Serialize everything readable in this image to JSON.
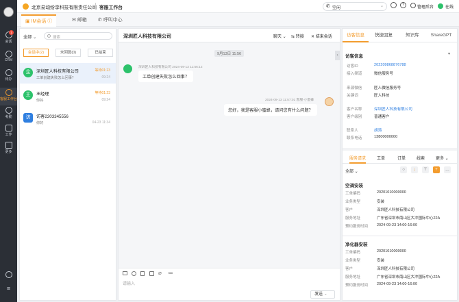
{
  "topbar": {
    "company": "北京易动纷享科技有限责任公司",
    "workspace": "客服工作台",
    "status_label": "空闲",
    "admin_label": "管理后台",
    "online_label": "在线"
  },
  "nav": {
    "items": [
      {
        "label": "会话",
        "badge": "1"
      },
      {
        "label": "CRM"
      },
      {
        "label": "待办"
      },
      {
        "label": "客服工作台"
      },
      {
        "label": "考勤"
      },
      {
        "label": "工作"
      },
      {
        "label": "更多"
      }
    ]
  },
  "tabs": [
    {
      "label": "IM会话"
    },
    {
      "label": "邮箱"
    },
    {
      "label": "呼叫中心"
    }
  ],
  "convlist": {
    "scope": "全部",
    "search_placeholder": "搜索",
    "filters": [
      "会话中(2)",
      "未回复(0)",
      "已结束"
    ],
    "items": [
      {
        "name": "深圳匠人科技有限公司",
        "msg": "工单创建失败怎么回事？",
        "time": "等待01:23",
        "time2": "09:24",
        "avatar": "企"
      },
      {
        "name": "王经理",
        "msg": "你好",
        "time": "等待01:23",
        "time2": "09:24",
        "avatar": "王"
      },
      {
        "name": "访客2203345556",
        "msg": "你好",
        "time": "",
        "time2": "04-23 11:34",
        "avatar": "访"
      }
    ]
  },
  "chat": {
    "title": "深圳匠人科技有限公司",
    "actions": {
      "chat": "聊天",
      "transfer": "转接",
      "end": "结束会话"
    },
    "date_divider": "9月13日 11:56",
    "msg1": {
      "meta": "深圳匠人科技有限公司 2024-09-13 11:56:12",
      "text": "工单创建失败怎么回事？"
    },
    "msg2": {
      "meta": "2024-09-13 11:57:01 客服-小蜜蜂",
      "text": "您好，我是客服小蜜蜂，请问您有什么问题？"
    },
    "input_placeholder": "请输入",
    "send_label": "发送"
  },
  "right": {
    "tabs": [
      "访客信息",
      "快捷回复",
      "知识库",
      "ShareGPT"
    ],
    "section_title": "访客信息",
    "fields": [
      {
        "k": "访客ID",
        "v": "202209868876788",
        "link": true
      },
      {
        "k": "接入渠道",
        "v": "微信服务号"
      },
      {
        "k": "来源微信",
        "v": "匠人微信服务号"
      },
      {
        "k": "关键词",
        "v": "匠人科技"
      },
      {
        "k": "客户名称",
        "v": "深圳匠人科技有限公司",
        "link": true
      },
      {
        "k": "客户级别",
        "v": "普通客户"
      },
      {
        "k": "联系人",
        "v": "胡涛",
        "link": true
      },
      {
        "k": "联系电话",
        "v": "13800000000"
      }
    ],
    "subtabs": [
      "服务请求",
      "工单",
      "订单",
      "线索",
      "更多"
    ],
    "scope": "全部",
    "cards": [
      {
        "title": "空调安装",
        "rows": [
          [
            "工单编码",
            "20201010000000"
          ],
          [
            "业务类型",
            "安装"
          ],
          [
            "客户",
            "深圳匠人科技有限公司"
          ],
          [
            "服务地址",
            "广东省深圳市南山区大冲国际中心22A"
          ],
          [
            "预约服务时间",
            "2024-09-23 14:00-16:00"
          ]
        ]
      },
      {
        "title": "净化器安装",
        "rows": [
          [
            "工单编码",
            "20201010000000"
          ],
          [
            "业务类型",
            "安装"
          ],
          [
            "客户",
            "深圳匠人科技有限公司"
          ],
          [
            "服务地址",
            "广东省深圳市南山区大冲国际中心22A"
          ],
          [
            "预约服务时间",
            "2024-09-23 14:00-16:00"
          ]
        ]
      }
    ]
  }
}
